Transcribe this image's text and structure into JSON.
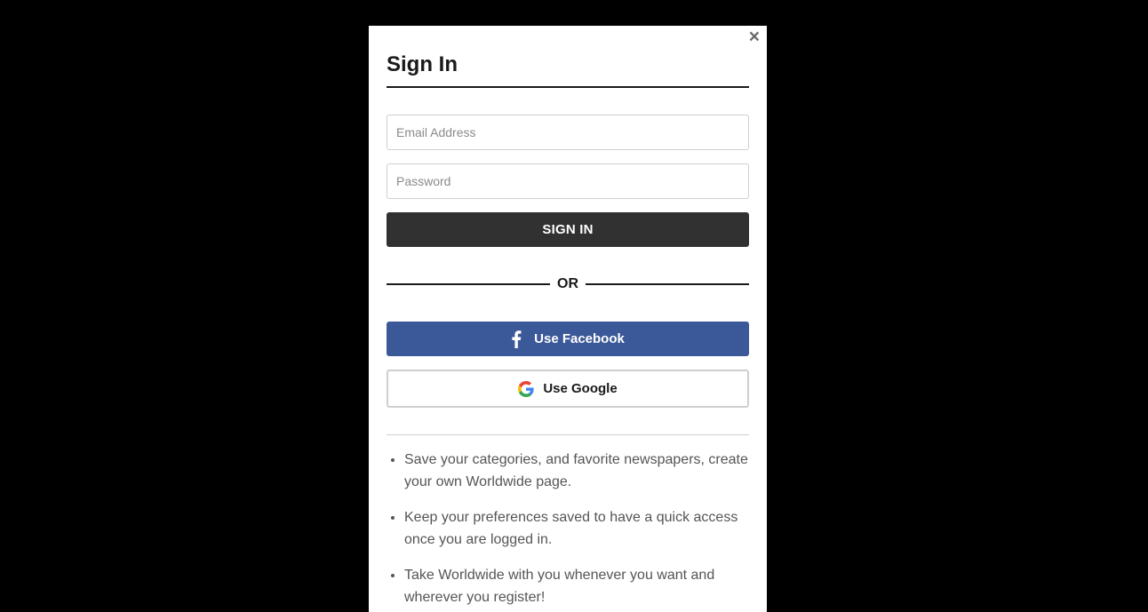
{
  "modal": {
    "close_label": "×",
    "title": "Sign In",
    "email_placeholder": "Email Address",
    "password_placeholder": "Password",
    "signin_label": "SIGN IN",
    "or_label": "OR",
    "facebook_label": "Use Facebook",
    "google_label": "Use Google",
    "benefits": [
      "Save your categories, and favorite newspapers, create your own Worldwide page.",
      "Keep your preferences saved to have a quick access once you are logged in.",
      "Take Worldwide with you whenever you want and wherever you register!"
    ]
  },
  "colors": {
    "overlay": "#000000",
    "signin_button": "#313131",
    "facebook": "#3b5998",
    "text_dark": "#1a1a1a",
    "text_muted": "#555555"
  },
  "icons": {
    "close": "close-icon",
    "facebook": "facebook-icon",
    "google": "google-icon"
  }
}
